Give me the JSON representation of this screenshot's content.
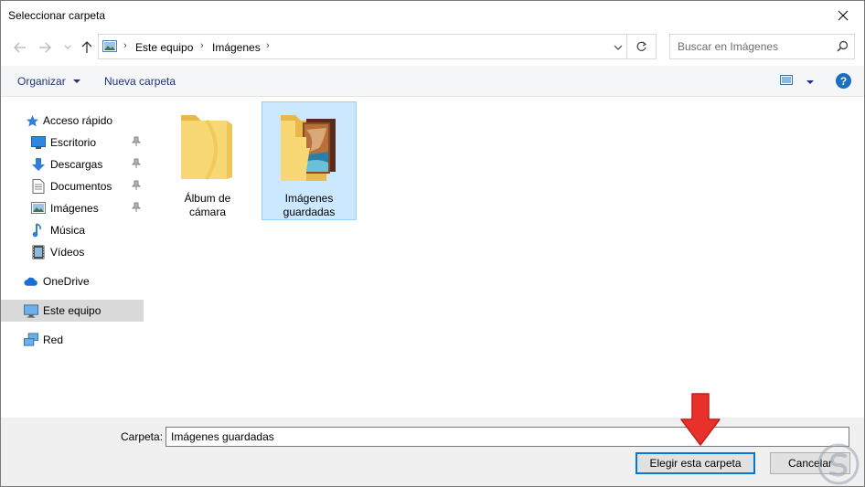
{
  "window": {
    "title": "Seleccionar carpeta"
  },
  "navigation": {
    "breadcrumb": [
      "Este equipo",
      "Imágenes"
    ],
    "search_placeholder": "Buscar en Imágenes"
  },
  "toolbar": {
    "organize_label": "Organizar",
    "new_folder_label": "Nueva carpeta",
    "help_label": "?"
  },
  "sidebar": {
    "items": [
      {
        "label": "Acceso rápido",
        "icon": "star-icon",
        "pinned": false
      },
      {
        "label": "Escritorio",
        "icon": "desktop-icon",
        "pinned": true
      },
      {
        "label": "Descargas",
        "icon": "download-icon",
        "pinned": true
      },
      {
        "label": "Documentos",
        "icon": "document-icon",
        "pinned": true
      },
      {
        "label": "Imágenes",
        "icon": "pictures-icon",
        "pinned": true
      },
      {
        "label": "Música",
        "icon": "music-icon",
        "pinned": false
      },
      {
        "label": "Vídeos",
        "icon": "video-icon",
        "pinned": false
      },
      {
        "label": "OneDrive",
        "icon": "cloud-icon",
        "pinned": false
      },
      {
        "label": "Este equipo",
        "icon": "computer-icon",
        "pinned": false,
        "selected": true
      },
      {
        "label": "Red",
        "icon": "network-icon",
        "pinned": false
      }
    ]
  },
  "folders": [
    {
      "label_line1": "Álbum de",
      "label_line2": "cámara",
      "selected": false
    },
    {
      "label_line1": "Imágenes",
      "label_line2": "guardadas",
      "selected": true
    }
  ],
  "footer": {
    "folder_label": "Carpeta:",
    "folder_value": "Imágenes guardadas",
    "choose_button": "Elegir esta carpeta",
    "cancel_button": "Cancelar"
  },
  "colors": {
    "accent": "#0078d7",
    "selection_bg": "#cce8ff",
    "folder_yellow": "#f8d775",
    "annotation_red": "#e8312a"
  }
}
